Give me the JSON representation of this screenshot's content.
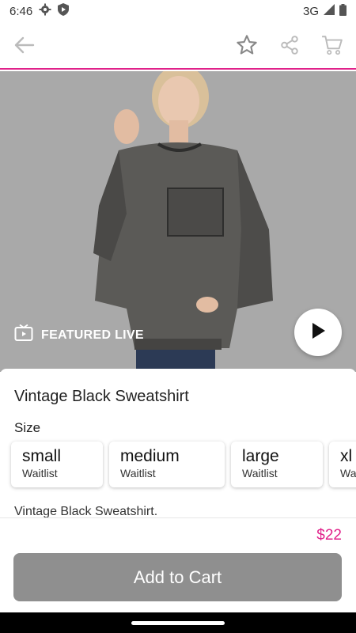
{
  "status_bar": {
    "time": "6:46",
    "network": "3G"
  },
  "hero": {
    "featured_label": "FEATURED LIVE"
  },
  "product": {
    "title": "Vintage Black Sweatshirt",
    "size_label": "Size",
    "sizes": [
      {
        "name": "small",
        "status": "Waitlist"
      },
      {
        "name": "medium",
        "status": "Waitlist"
      },
      {
        "name": "large",
        "status": "Waitlist"
      },
      {
        "name": "xl",
        "status": "Waitlist"
      }
    ],
    "description": "Vintage Black Sweatshirt.",
    "price": "$22"
  },
  "actions": {
    "add_to_cart": "Add to Cart"
  },
  "colors": {
    "accent": "#e0218a",
    "button_bg": "#8f8f8f",
    "hero_bg": "#a9a9a9"
  }
}
